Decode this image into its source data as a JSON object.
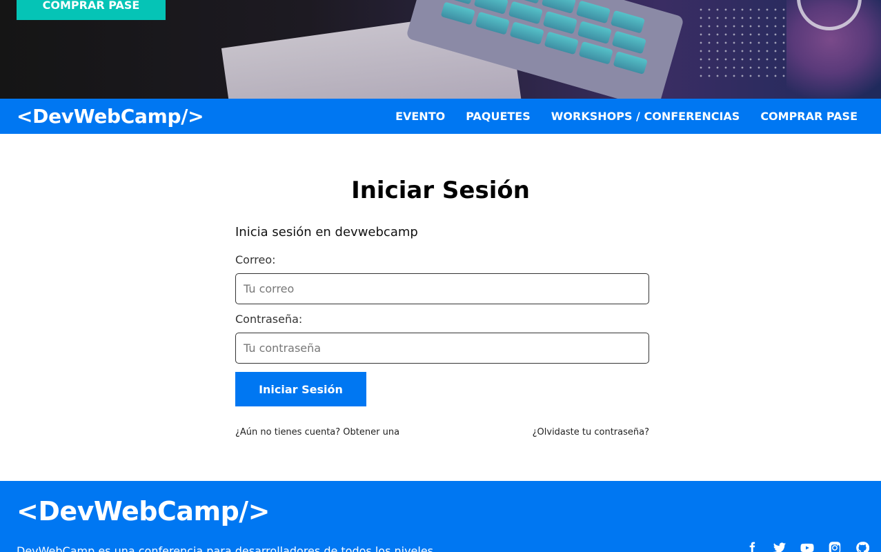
{
  "hero": {
    "cta_label": "COMPRAR PASE"
  },
  "nav": {
    "brand": "<DevWebCamp/>",
    "links": [
      {
        "label": "EVENTO"
      },
      {
        "label": "PAQUETES"
      },
      {
        "label": "WORKSHOPS / CONFERENCIAS"
      },
      {
        "label": "COMPRAR PASE"
      }
    ]
  },
  "main": {
    "title": "Iniciar Sesión",
    "subtitle": "Inicia sesión en devwebcamp",
    "email": {
      "label": "Correo:",
      "placeholder": "Tu correo",
      "value": ""
    },
    "password": {
      "label": "Contraseña:",
      "placeholder": "Tu contraseña",
      "value": ""
    },
    "submit_label": "Iniciar Sesión",
    "register_link": "¿Aún no tienes cuenta? Obtener una",
    "forgot_link": "¿Olvidaste tu contraseña?"
  },
  "footer": {
    "brand": "<DevWebCamp/>",
    "description": "DevWebCamp es una conferencia para desarrolladores de todos los niveles",
    "socials": [
      "facebook-icon",
      "twitter-icon",
      "youtube-icon",
      "instagram-icon",
      "github-icon"
    ]
  },
  "colors": {
    "primary_blue": "#0077f2",
    "teal": "#05c4b6"
  }
}
